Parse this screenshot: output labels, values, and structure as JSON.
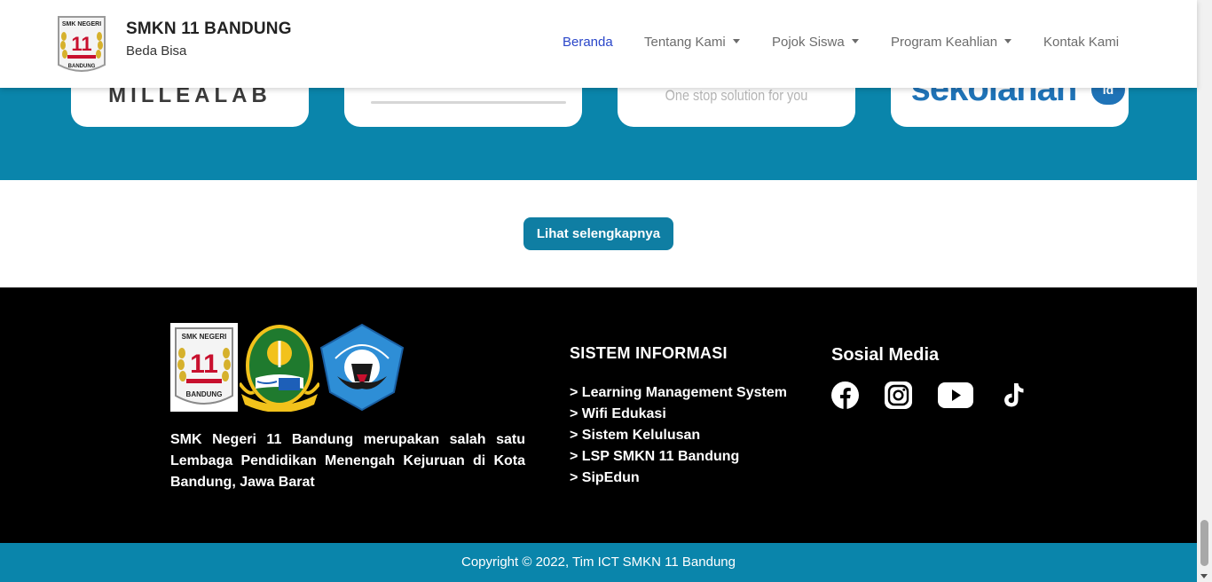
{
  "navbar": {
    "logo_text_top": "SMK NEGERI",
    "logo_number": "11",
    "logo_text_bottom": "BANDUNG",
    "title": "SMKN 11 BANDUNG",
    "tagline": "Beda Bisa",
    "items": [
      {
        "label": "Beranda",
        "active": true,
        "dropdown": false
      },
      {
        "label": "Tentang Kami",
        "active": false,
        "dropdown": true
      },
      {
        "label": "Pojok Siswa",
        "active": false,
        "dropdown": true
      },
      {
        "label": "Program Keahlian",
        "active": false,
        "dropdown": true
      },
      {
        "label": "Kontak Kami",
        "active": false,
        "dropdown": false
      }
    ]
  },
  "partners": [
    {
      "text": "MILLEALAB"
    },
    {
      "text": ""
    },
    {
      "text": "One stop solution for you"
    },
    {
      "text": "sekolahan",
      "suffix": "id"
    }
  ],
  "more_button": "Lihat selengkapnya",
  "footer": {
    "logo_smk_top": "SMK NEGERI",
    "logo_smk_number": "11",
    "logo_smk_bottom": "BANDUNG",
    "about": "SMK Negeri 11 Bandung merupakan salah satu Lembaga Pendidikan Menengah Kejuruan di Kota Bandung, Jawa Barat",
    "si_title": "SISTEM INFORMASI",
    "si_links": [
      "> Learning Management System",
      "> Wifi Edukasi",
      "> Sistem Kelulusan",
      "> LSP SMKN 11 Bandung",
      "> SipEdun"
    ],
    "sm_title": "Sosial Media",
    "social_icons": [
      "facebook-icon",
      "instagram-icon",
      "youtube-icon",
      "tiktok-icon"
    ]
  },
  "copyright": "Copyright © 2022, Tim ICT SMKN 11 Bandung",
  "colors": {
    "brand_teal": "#0a85ab",
    "button_teal": "#0f7ea3",
    "nav_active": "#2a46c9",
    "footer_bg": "#000000"
  }
}
